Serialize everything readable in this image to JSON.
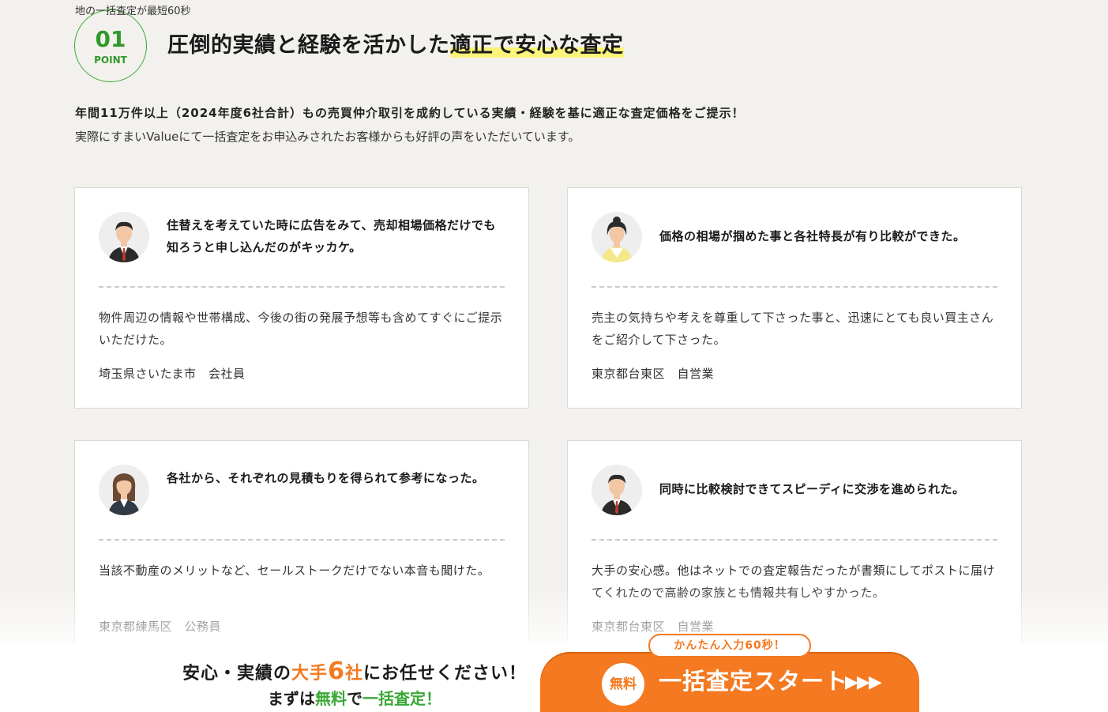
{
  "header": {
    "overflow_text": "地の一括査定が最短60秒",
    "point_number": "01",
    "point_label": "POINT",
    "title_main": "圧倒的実績と経験を活かした",
    "title_highlight": "適正で安心な査定"
  },
  "lead": {
    "line1": "年間11万件以上（2024年度6社合計）もの売買仲介取引を成約している実績・経験を基に適正な査定価格をご提示！",
    "line2": "実際にすまいValueにて一括査定をお申込みされたお客様からも好評の声をいただいています。"
  },
  "testimonials": [
    {
      "avatar": "man-suit-red-tie-avatar",
      "headline": "住替えを考えていた時に広告をみて、売却相場価格だけでも知ろうと申し込んだのがキッカケ。",
      "body": "物件周辺の情報や世帯構成、今後の街の発展予想等も含めてすぐにご提示いただけた。",
      "author": "埼玉県さいたま市　会社員"
    },
    {
      "avatar": "woman-yellow-vest-avatar",
      "headline": "価格の相場が掴めた事と各社特長が有り比較ができた。",
      "body": "売主の気持ちや考えを尊重して下さった事と、迅速にとても良い買主さんをご紹介して下さった。",
      "author": "東京都台東区　自営業"
    },
    {
      "avatar": "woman-dark-suit-avatar",
      "headline": "各社から、それぞれの見積もりを得られて参考になった。",
      "body": "当該不動産のメリットなど、セールストークだけでない本音も聞けた。",
      "author": "東京都練馬区　公務員"
    },
    {
      "avatar": "man-suit-red-tie-avatar",
      "headline": "同時に比較検討できてスピーディに交渉を進められた。",
      "body": "大手の安心感。他はネットでの査定報告だったが書類にしてポストに届けてくれたので高齢の家族とも情報共有しやすかった。",
      "author": "東京都台東区　自営業"
    }
  ],
  "cta": {
    "msg_part1": "安心・実績の",
    "msg_big1": "大手",
    "msg_big2": "6",
    "msg_big3": "社",
    "msg_part2": "にお任せください！",
    "msg2_part1": "まずは",
    "msg2_free": "無料",
    "msg2_part2": "で",
    "msg2_green": "一括査定！",
    "pill": "かんたん入力60秒！",
    "free_badge": "無料",
    "button_label": "一括査定スタート",
    "arrows": "▶▶▶"
  },
  "colors": {
    "accent_green": "#3aa836",
    "accent_orange": "#f47920",
    "highlight_yellow": "#fbf47a",
    "background": "#f3f1ed"
  }
}
